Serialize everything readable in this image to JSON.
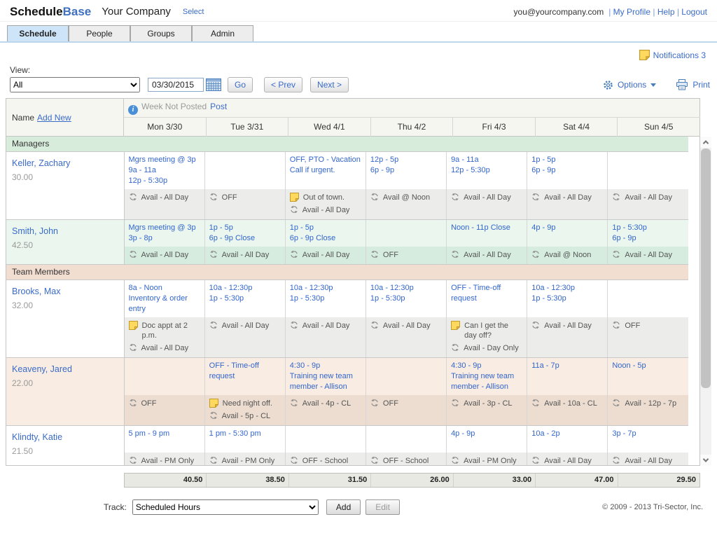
{
  "header": {
    "brand_part1": "Schedule",
    "brand_part2": "Base",
    "company": "Your Company",
    "select_link": "Select",
    "email": "you@yourcompany.com",
    "nav_links": [
      "My Profile",
      "Help",
      "Logout"
    ]
  },
  "tabs": [
    {
      "label": "Schedule",
      "active": true
    },
    {
      "label": "People",
      "active": false
    },
    {
      "label": "Groups",
      "active": false
    },
    {
      "label": "Admin",
      "active": false
    }
  ],
  "toolbar": {
    "notifications": "Notifications 3",
    "view_label": "View:",
    "view_value": "All",
    "date_value": "03/30/2015",
    "go": "Go",
    "prev": "< Prev",
    "next": "Next >",
    "options": "Options",
    "print": "Print"
  },
  "icons": {
    "notifications": "note-icon",
    "options": "gear-icon",
    "print": "printer-icon",
    "date_picker": "calendar-icon",
    "week_status": "info-icon",
    "availability": "recurring-icon",
    "cell_note": "note-icon"
  },
  "grid": {
    "name_header": "Name",
    "add_new_link": "Add New",
    "week_status": "Week Not Posted",
    "post_link": "Post",
    "days": [
      "Mon 3/30",
      "Tue 3/31",
      "Wed 4/1",
      "Thu 4/2",
      "Fri 4/3",
      "Sat 4/4",
      "Sun 4/5"
    ],
    "sections": [
      {
        "label": "Managers",
        "tint": "green",
        "people": [
          {
            "name": "Keller, Zachary",
            "hours": "30.00",
            "tinted": false,
            "cells": [
              {
                "shifts": [
                  "Mgrs meeting @ 3p",
                  "9a - 11a",
                  "12p - 5:30p"
                ],
                "sub": [
                  {
                    "type": "avail",
                    "text": "Avail - All Day"
                  }
                ]
              },
              {
                "shifts": [],
                "sub": [
                  {
                    "type": "avail",
                    "text": "OFF"
                  }
                ]
              },
              {
                "shifts": [
                  "OFF, PTO - Vacation",
                  "Call if urgent."
                ],
                "sub": [
                  {
                    "type": "note",
                    "text": "Out of town."
                  },
                  {
                    "type": "avail",
                    "text": "Avail - All Day"
                  }
                ]
              },
              {
                "shifts": [
                  "12p - 5p",
                  "6p - 9p"
                ],
                "sub": [
                  {
                    "type": "avail",
                    "text": "Avail @ Noon"
                  }
                ]
              },
              {
                "shifts": [
                  "9a - 11a",
                  "12p - 5:30p"
                ],
                "sub": [
                  {
                    "type": "avail",
                    "text": "Avail - All Day"
                  }
                ]
              },
              {
                "shifts": [
                  "1p - 5p",
                  "6p - 9p"
                ],
                "sub": [
                  {
                    "type": "avail",
                    "text": "Avail - All Day"
                  }
                ]
              },
              {
                "shifts": [],
                "sub": [
                  {
                    "type": "avail",
                    "text": "Avail - All Day"
                  }
                ]
              }
            ]
          },
          {
            "name": "Smith, John",
            "hours": "42.50",
            "tinted": true,
            "cells": [
              {
                "shifts": [
                  "Mgrs meeting @ 3p",
                  "3p - 8p"
                ],
                "sub": [
                  {
                    "type": "avail",
                    "text": "Avail - All Day"
                  }
                ]
              },
              {
                "shifts": [
                  "1p - 5p",
                  "6p - 9p Close"
                ],
                "sub": [
                  {
                    "type": "avail",
                    "text": "Avail - All Day"
                  }
                ]
              },
              {
                "shifts": [
                  "1p - 5p",
                  "6p - 9p Close"
                ],
                "sub": [
                  {
                    "type": "avail",
                    "text": "Avail - All Day"
                  }
                ]
              },
              {
                "shifts": [],
                "sub": [
                  {
                    "type": "avail",
                    "text": "OFF"
                  }
                ]
              },
              {
                "shifts": [
                  "Noon - 11p Close"
                ],
                "sub": [
                  {
                    "type": "avail",
                    "text": "Avail - All Day"
                  }
                ]
              },
              {
                "shifts": [
                  "4p - 9p"
                ],
                "sub": [
                  {
                    "type": "avail",
                    "text": "Avail @ Noon"
                  }
                ]
              },
              {
                "shifts": [
                  "1p - 5:30p",
                  "6p - 9p"
                ],
                "sub": [
                  {
                    "type": "avail",
                    "text": "Avail - All Day"
                  }
                ]
              }
            ]
          }
        ]
      },
      {
        "label": "Team Members",
        "tint": "tan",
        "people": [
          {
            "name": "Brooks, Max",
            "hours": "32.00",
            "tinted": false,
            "cells": [
              {
                "shifts": [
                  "8a - Noon",
                  "Inventory & order entry"
                ],
                "sub": [
                  {
                    "type": "note",
                    "text": "Doc appt at 2 p.m."
                  },
                  {
                    "type": "avail",
                    "text": "Avail - All Day"
                  }
                ]
              },
              {
                "shifts": [
                  "10a - 12:30p",
                  "1p - 5:30p"
                ],
                "sub": [
                  {
                    "type": "avail",
                    "text": "Avail - All Day"
                  }
                ]
              },
              {
                "shifts": [
                  "10a - 12:30p",
                  "1p - 5:30p"
                ],
                "sub": [
                  {
                    "type": "avail",
                    "text": "Avail - All Day"
                  }
                ]
              },
              {
                "shifts": [
                  "10a - 12:30p",
                  "1p - 5:30p"
                ],
                "sub": [
                  {
                    "type": "avail",
                    "text": "Avail - All Day"
                  }
                ]
              },
              {
                "shifts": [
                  "OFF - Time-off request"
                ],
                "sub": [
                  {
                    "type": "note",
                    "text": "Can I get the day off?"
                  },
                  {
                    "type": "avail",
                    "text": "Avail - Day Only"
                  }
                ]
              },
              {
                "shifts": [
                  "10a - 12:30p",
                  "1p - 5:30p"
                ],
                "sub": [
                  {
                    "type": "avail",
                    "text": "Avail - All Day"
                  }
                ]
              },
              {
                "shifts": [],
                "sub": [
                  {
                    "type": "avail",
                    "text": "OFF"
                  }
                ]
              }
            ]
          },
          {
            "name": "Keaveny, Jared",
            "hours": "22.00",
            "tinted": true,
            "cells": [
              {
                "shifts": [],
                "sub": [
                  {
                    "type": "avail",
                    "text": "OFF"
                  }
                ]
              },
              {
                "shifts": [
                  "OFF - Time-off request"
                ],
                "sub": [
                  {
                    "type": "note",
                    "text": "Need night off."
                  },
                  {
                    "type": "avail",
                    "text": "Avail - 5p - CL"
                  }
                ]
              },
              {
                "shifts": [
                  "4:30 - 9p",
                  "Training new team member - Allison"
                ],
                "sub": [
                  {
                    "type": "avail",
                    "text": "Avail - 4p - CL"
                  }
                ]
              },
              {
                "shifts": [],
                "sub": [
                  {
                    "type": "avail",
                    "text": "OFF"
                  }
                ]
              },
              {
                "shifts": [
                  "4:30 - 9p",
                  "Training new team member - Allison"
                ],
                "sub": [
                  {
                    "type": "avail",
                    "text": "Avail - 3p - CL"
                  }
                ]
              },
              {
                "shifts": [
                  "11a - 7p"
                ],
                "sub": [
                  {
                    "type": "avail",
                    "text": "Avail - 10a - CL"
                  }
                ]
              },
              {
                "shifts": [
                  "Noon - 5p"
                ],
                "sub": [
                  {
                    "type": "avail",
                    "text": "Avail - 12p - 7p"
                  }
                ]
              }
            ]
          },
          {
            "name": "Klindty, Katie",
            "hours": "21.50",
            "tinted": false,
            "cells": [
              {
                "shifts": [
                  "5 pm - 9 pm"
                ],
                "sub": [
                  {
                    "type": "avail",
                    "text": "Avail - PM Only"
                  }
                ]
              },
              {
                "shifts": [
                  "1 pm - 5:30 pm"
                ],
                "sub": [
                  {
                    "type": "avail",
                    "text": "Avail - PM Only"
                  }
                ]
              },
              {
                "shifts": [],
                "sub": [
                  {
                    "type": "avail",
                    "text": "OFF - School"
                  }
                ]
              },
              {
                "shifts": [],
                "sub": [
                  {
                    "type": "avail",
                    "text": "OFF - School"
                  }
                ]
              },
              {
                "shifts": [
                  "4p - 9p"
                ],
                "sub": [
                  {
                    "type": "avail",
                    "text": "Avail - PM Only"
                  }
                ]
              },
              {
                "shifts": [
                  "10a - 2p"
                ],
                "sub": [
                  {
                    "type": "avail",
                    "text": "Avail - All Day"
                  }
                ]
              },
              {
                "shifts": [
                  "3p - 7p"
                ],
                "sub": [
                  {
                    "type": "avail",
                    "text": "Avail - All Day"
                  }
                ]
              }
            ]
          }
        ]
      }
    ],
    "totals": [
      "40.50",
      "38.50",
      "31.50",
      "26.00",
      "33.00",
      "47.00",
      "29.50"
    ]
  },
  "footer": {
    "track_label": "Track:",
    "track_value": "Scheduled Hours",
    "add_button": "Add",
    "edit_button": "Edit",
    "copyright": "© 2009 - 2013 Tri-Sector, Inc."
  },
  "colors": {
    "link_blue": "#3a6bc7",
    "shift_blue": "#3366cc",
    "managers_tint": "#d8ecdc",
    "team_members_tint": "#f2ddd1",
    "note_yellow": "#ffd95e",
    "icon_blue": "#4a7ebb"
  }
}
